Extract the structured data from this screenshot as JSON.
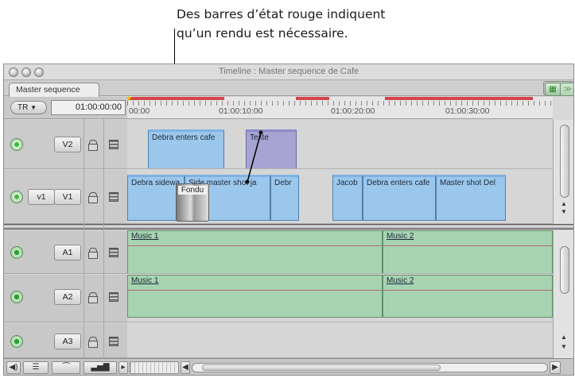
{
  "callout": {
    "line1": "Des barres d’état rouge indiquent",
    "line2": "qu’un rendu est nécessaire."
  },
  "window": {
    "title": "Timeline : Master sequence de Cafe",
    "tab_label": "Master sequence"
  },
  "toolbar": {
    "track_popup": "TR",
    "timecode": "01:00:00:00"
  },
  "ruler": {
    "labels": [
      "00:00",
      "01:00:10:00",
      "01:00:20:00",
      "01:00:30:00"
    ]
  },
  "tracks": {
    "v2": {
      "dest": "V2"
    },
    "v1": {
      "source": "v1",
      "dest": "V1"
    },
    "a1": {
      "dest": "A1"
    },
    "a2": {
      "dest": "A2"
    },
    "a3": {
      "dest": "A3"
    }
  },
  "clips": {
    "v2": [
      "Debra enters cafe",
      "Texte"
    ],
    "v1": [
      "Debra sidewa",
      "Side master shot ja",
      "Debr",
      "Jacob",
      "Debra enters cafe",
      "Master shot Del"
    ],
    "transition": "Fondu",
    "a1": [
      "Music 1",
      "Music 2"
    ],
    "a2": [
      "Music 1",
      "Music 2"
    ]
  },
  "colors": {
    "render_bar": "#d6454b",
    "video_clip": "#9cc7ec",
    "title_clip": "#a7a4d3",
    "audio_clip": "#a7d3b1"
  },
  "icons": {
    "lock": "lock-icon",
    "link": "link-icon",
    "visibility": "track-visibility-icon",
    "speaker": "audio-enable-icon"
  }
}
